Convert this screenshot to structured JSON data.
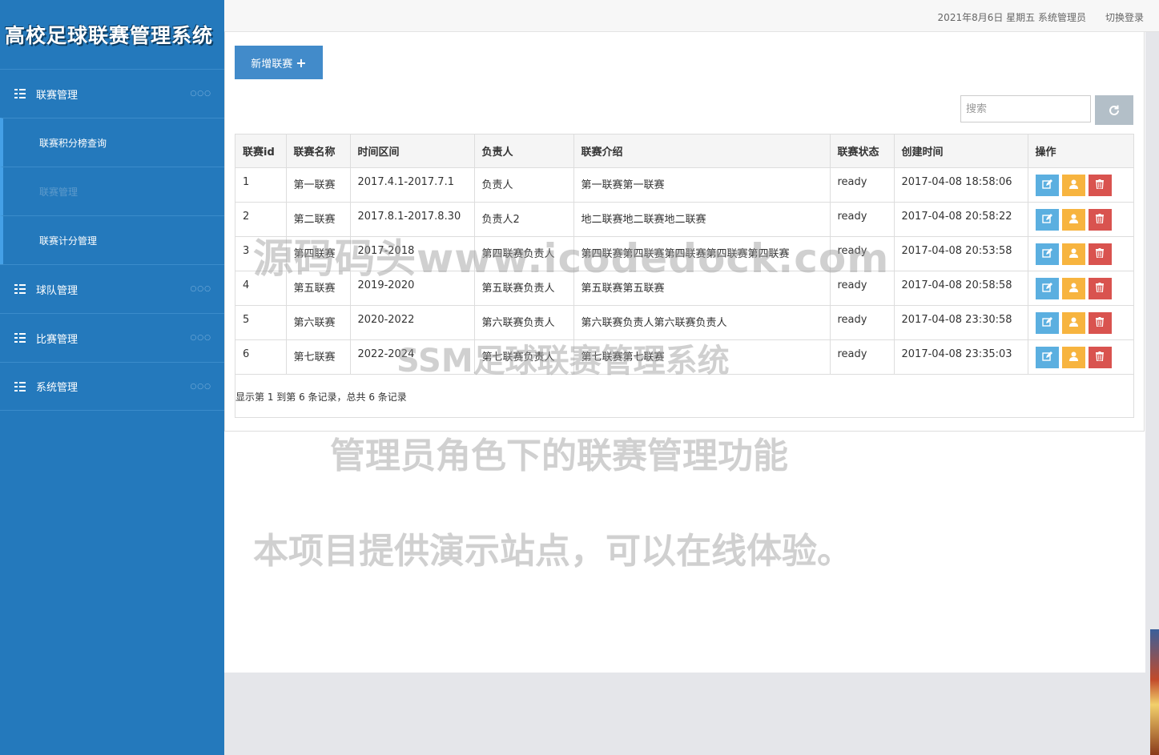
{
  "app": {
    "title": "高校足球联赛管理系统"
  },
  "sidebar": {
    "groups": [
      {
        "label": "联赛管理",
        "dots": "○○○"
      },
      {
        "label": "球队管理",
        "dots": "○○○"
      },
      {
        "label": "比赛管理",
        "dots": "○○○"
      },
      {
        "label": "系统管理",
        "dots": "○○○"
      }
    ],
    "subitems": [
      {
        "label": "联赛积分榜查询"
      },
      {
        "label": "联赛管理"
      },
      {
        "label": "联赛计分管理"
      }
    ]
  },
  "topbar": {
    "date_user": "2021年8月6日 星期五 系统管理员",
    "logout": "切换登录"
  },
  "toolbar": {
    "add_label": "新增联赛",
    "add_icon": "plus-icon",
    "refresh_icon": "refresh-icon"
  },
  "search": {
    "placeholder": "搜索"
  },
  "table": {
    "headers": [
      "联赛id",
      "联赛名称",
      "时间区间",
      "负责人",
      "联赛介绍",
      "联赛状态",
      "创建时间",
      "操作"
    ],
    "rows": [
      [
        "1",
        "第一联赛",
        "2017.4.1-2017.7.1",
        "负责人",
        "第一联赛第一联赛",
        "ready",
        "2017-04-08 18:58:06"
      ],
      [
        "2",
        "第二联赛",
        "2017.8.1-2017.8.30",
        "负责人2",
        "地二联赛地二联赛地二联赛",
        "ready",
        "2017-04-08 20:58:22"
      ],
      [
        "3",
        "第四联赛",
        "2017-2018",
        "第四联赛负责人",
        "第四联赛第四联赛第四联赛第四联赛第四联赛",
        "ready",
        "2017-04-08 20:53:58"
      ],
      [
        "4",
        "第五联赛",
        "2019-2020",
        "第五联赛负责人",
        "第五联赛第五联赛",
        "ready",
        "2017-04-08 20:58:58"
      ],
      [
        "5",
        "第六联赛",
        "2020-2022",
        "第六联赛负责人",
        "第六联赛负责人第六联赛负责人",
        "ready",
        "2017-04-08 23:30:58"
      ],
      [
        "6",
        "第七联赛",
        "2022-2024",
        "第七联赛负责人",
        "第七联赛第七联赛",
        "ready",
        "2017-04-08 23:35:03"
      ]
    ],
    "action_icons": [
      "edit-icon",
      "user-icon",
      "trash-icon"
    ]
  },
  "pager": {
    "text": "显示第 1 到第 6 条记录，总共 6 条记录"
  },
  "watermarks": [
    "源码码头www.icodedock.com",
    "SSM足球联赛管理系统",
    "管理员角色下的联赛管理功能",
    "本项目提供演示站点，可以在线体验。"
  ],
  "colors": {
    "sidebar": "#2479bc",
    "primary": "#428bca",
    "edit": "#5bafe0",
    "user": "#f7b43f",
    "delete": "#d9534f"
  }
}
